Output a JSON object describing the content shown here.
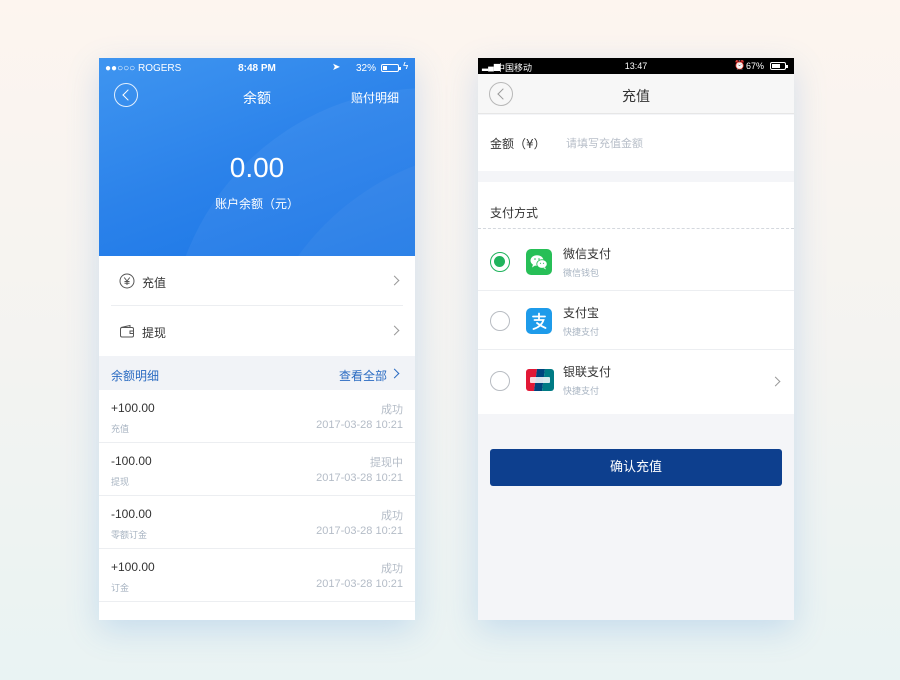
{
  "left_screen": {
    "status_bar": {
      "carrier": "●●○○○ ROGERS",
      "time": "8:48 PM",
      "battery": "32%",
      "battery_level": 0.32
    },
    "header": {
      "title": "余额",
      "right_link": "赔付明细"
    },
    "balance": {
      "amount": "0.00",
      "label": "账户余额（元）"
    },
    "menu": [
      {
        "label": "充值",
        "icon": "yen-coin-icon"
      },
      {
        "label": "提现",
        "icon": "wallet-icon"
      }
    ],
    "section": {
      "title": "余额明细",
      "view_all": "查看全部"
    },
    "transactions": [
      {
        "amount": "+100.00",
        "type": "充值",
        "status": "成功",
        "time": "2017-03-28 10:21"
      },
      {
        "amount": "-100.00",
        "type": "提现",
        "status": "提现中",
        "time": "2017-03-28 10:21"
      },
      {
        "amount": "-100.00",
        "type": "零额订金",
        "status": "成功",
        "time": "2017-03-28 10:21"
      },
      {
        "amount": "+100.00",
        "type": "订金",
        "status": "成功",
        "time": "2017-03-28 10:21"
      }
    ],
    "colors": {
      "header_blue": "#2b82ea",
      "link_blue": "#2a6bc2"
    }
  },
  "right_screen": {
    "status_bar": {
      "carrier": "中国移动",
      "time": "13:47",
      "battery": "67%",
      "battery_level": 0.67
    },
    "header": {
      "title": "充值"
    },
    "amount_field": {
      "label": "金额（¥）",
      "placeholder": "请填写充值金额"
    },
    "payment": {
      "title": "支付方式",
      "methods": [
        {
          "name": "微信支付",
          "sub": "微信钱包",
          "icon": "wechat-icon",
          "selected": true
        },
        {
          "name": "支付宝",
          "sub": "快捷支付",
          "icon": "alipay-icon",
          "selected": false
        },
        {
          "name": "银联支付",
          "sub": "快捷支付",
          "icon": "unionpay-icon",
          "selected": false
        }
      ]
    },
    "confirm_button": "确认充值",
    "colors": {
      "button_blue": "#0d3f8e",
      "selected_green": "#1fb35c"
    }
  }
}
